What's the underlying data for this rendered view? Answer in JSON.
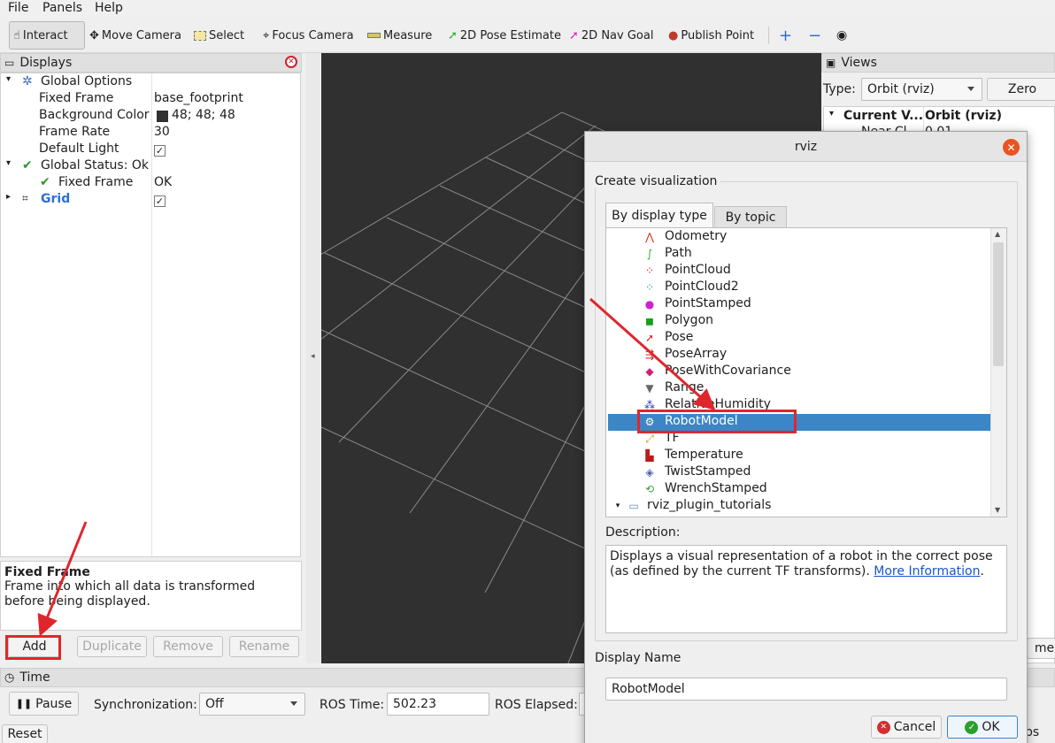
{
  "menu": [
    "File",
    "Panels",
    "Help"
  ],
  "toolbar": {
    "interact": "Interact",
    "move_camera": "Move Camera",
    "select": "Select",
    "focus_camera": "Focus Camera",
    "measure": "Measure",
    "pose_estimate": "2D Pose Estimate",
    "nav_goal": "2D Nav Goal",
    "publish_point": "Publish Point"
  },
  "displays": {
    "title": "Displays",
    "global_options": "Global Options",
    "fixed_frame_label": "Fixed Frame",
    "fixed_frame_value": "base_footprint",
    "bg_color_label": "Background Color",
    "bg_color_value": "48; 48; 48",
    "bg_color_hex": "#303030",
    "frame_rate_label": "Frame Rate",
    "frame_rate_value": "30",
    "default_light_label": "Default Light",
    "global_status": "Global Status: Ok",
    "status_fixed_frame": "Fixed Frame",
    "status_fixed_frame_value": "OK",
    "grid": "Grid",
    "desc_title": "Fixed Frame",
    "desc_text": "Frame into which all data is transformed before being displayed.",
    "buttons": {
      "add": "Add",
      "duplicate": "Duplicate",
      "remove": "Remove",
      "rename": "Rename"
    }
  },
  "views": {
    "title": "Views",
    "type_label": "Type:",
    "type_value": "Orbit (rviz)",
    "zero": "Zero",
    "col1": "Current V...",
    "col2": "Orbit (rviz)",
    "row_name": "Near Cl...",
    "row_value": "0.01",
    "partial_button": "me"
  },
  "time": {
    "title": "Time",
    "pause": "Pause",
    "sync_label": "Synchronization:",
    "sync_value": "Off",
    "ros_time_label": "ROS Time:",
    "ros_time_value": "502.23",
    "ros_elapsed_label": "ROS Elapsed:",
    "reset": "Reset",
    "fps_partial": "ps"
  },
  "dialog": {
    "title": "rviz",
    "header": "Create visualization",
    "tab_display_type": "By display type",
    "tab_topic": "By topic",
    "items": [
      "Odometry",
      "Path",
      "PointCloud",
      "PointCloud2",
      "PointStamped",
      "Polygon",
      "Pose",
      "PoseArray",
      "PoseWithCovariance",
      "Range",
      "RelativeHumidity",
      "RobotModel",
      "TF",
      "Temperature",
      "TwistStamped",
      "WrenchStamped"
    ],
    "folder": "rviz_plugin_tutorials",
    "selected": "RobotModel",
    "description_label": "Description:",
    "description_text": "Displays a visual representation of a robot in the correct pose (as defined by the current TF transforms). ",
    "description_link": "More Information",
    "display_name_label": "Display Name",
    "display_name_value": "RobotModel",
    "cancel": "Cancel",
    "ok": "OK"
  },
  "colors": {
    "annotation_red": "#e0262d",
    "selection_blue": "#3a86c6",
    "viewport_bg": "#303030",
    "close_orange": "#e95420"
  }
}
